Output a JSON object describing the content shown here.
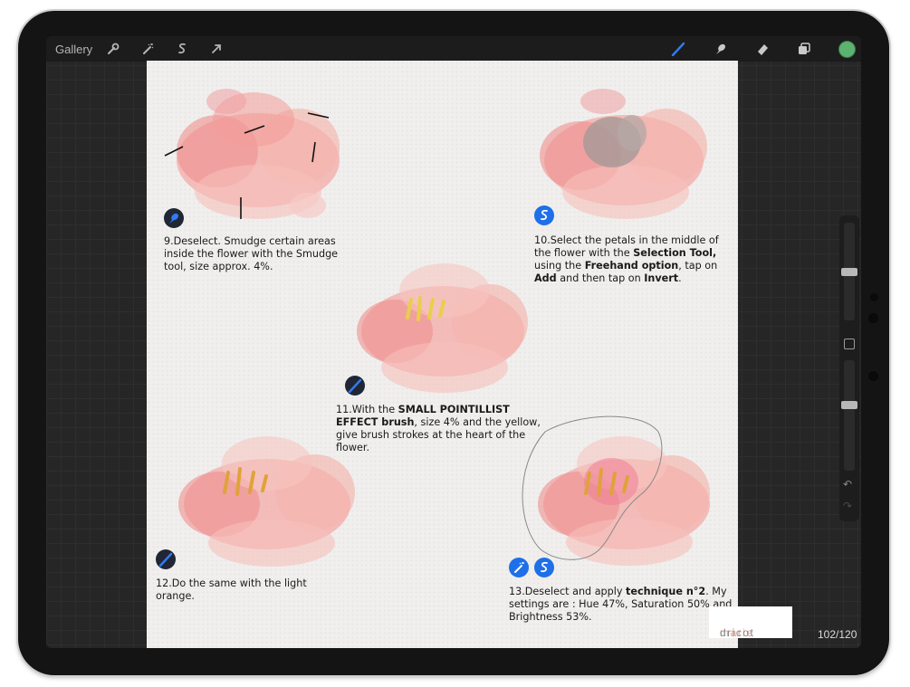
{
  "toolbar": {
    "gallery_label": "Gallery",
    "left_icons": [
      "wrench-icon",
      "magic-wand-icon",
      "selection-icon",
      "transform-arrow-icon"
    ],
    "right_icons": [
      "brush-icon",
      "smudge-icon",
      "eraser-icon",
      "layers-icon",
      "color-swatch"
    ],
    "accent_color": "#2f7bf5",
    "color_swatch": "#5bb36f"
  },
  "sidebar": {
    "size_slider_fraction": 0.5,
    "opacity_slider_fraction": 0.6
  },
  "steps": {
    "s9": {
      "text": "9.Deselect. Smudge certain areas inside the flower with the Smudge tool, size approx. 4%."
    },
    "s10": {
      "t1": "10.Select the petals in the middle of the flower with the ",
      "b1": "Selection Tool,",
      "t2": " using the ",
      "b2": "Freehand option",
      "t3": ", tap on ",
      "b3": "Add",
      "t4": " and then tap on ",
      "b4": "Invert",
      "t5": "."
    },
    "s11": {
      "t1": "11.With the ",
      "b1": "SMALL POINTILLIST EFFECT brush",
      "t2": ", size 4% and the yellow, give brush strokes at the heart of the flower."
    },
    "s12": {
      "text": "12.Do the same with the light orange."
    },
    "s13": {
      "t1": "13.Deselect and apply ",
      "b1": "technique n°2",
      "t2": ". My settings are : Hue 47%, Saturation 50% and Brightness 53%."
    }
  },
  "logo": {
    "part1": "marie ",
    "part2": "dricot"
  },
  "page_indicator": "102/120"
}
